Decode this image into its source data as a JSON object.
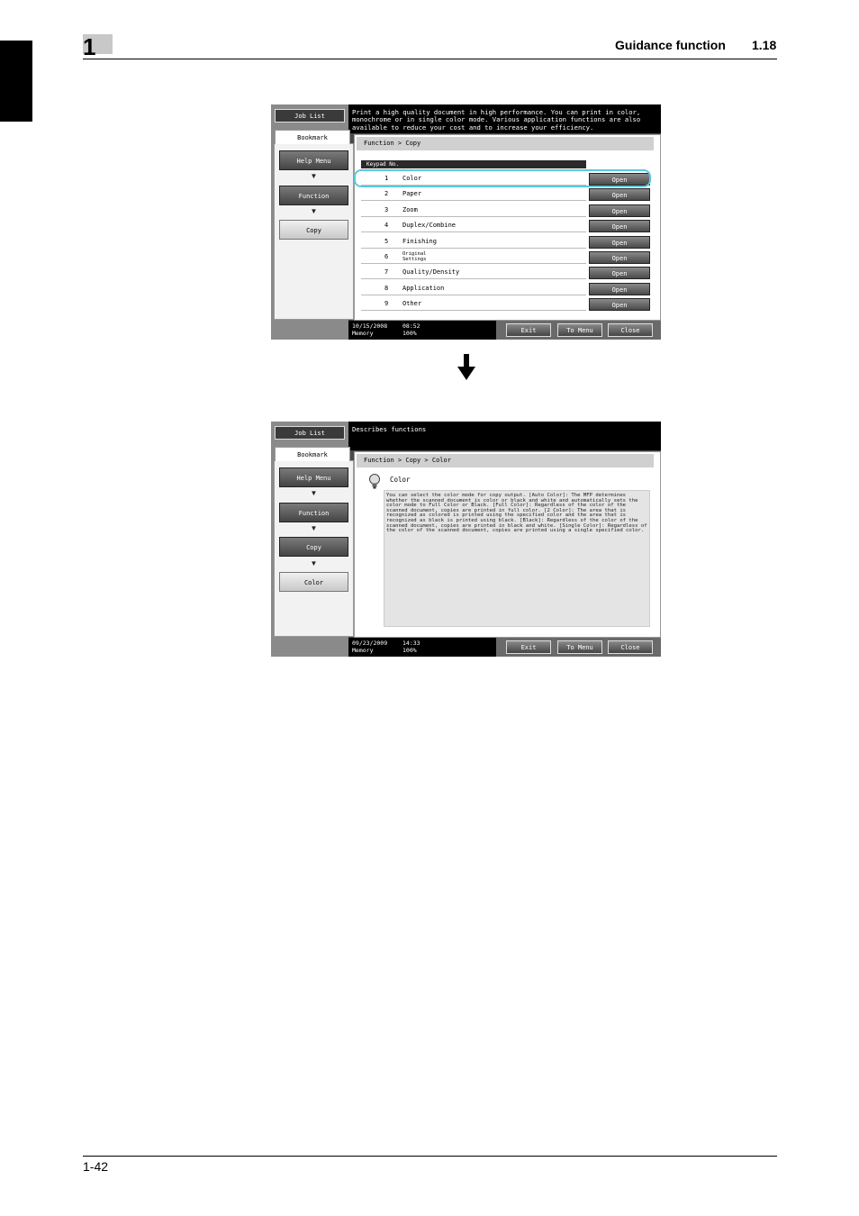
{
  "header": {
    "chapter": "1",
    "title": "Guidance function",
    "section": "1.18"
  },
  "footer": {
    "page": "1-42"
  },
  "screen1": {
    "message": "Print a high quality document in high performance. You can print in color, monochrome or in single color mode. Various application functions are also available to reduce your cost and to increase your efficiency.",
    "job_list": "Job List",
    "bookmark": "Bookmark",
    "nav": [
      "Help Menu",
      "Function",
      "Copy"
    ],
    "breadcrumb": "Function > Copy",
    "keypad_header": "Keypad No.",
    "items": [
      {
        "num": "1",
        "label": "Color"
      },
      {
        "num": "2",
        "label": "Paper"
      },
      {
        "num": "3",
        "label": "Zoom"
      },
      {
        "num": "4",
        "label": "Duplex/Combine"
      },
      {
        "num": "5",
        "label": "Finishing"
      },
      {
        "num": "6",
        "label": "Original Settings"
      },
      {
        "num": "7",
        "label": "Quality/Density"
      },
      {
        "num": "8",
        "label": "Application"
      },
      {
        "num": "9",
        "label": "Other"
      }
    ],
    "open_label": "Open",
    "date": "10/15/2008",
    "time": "08:52",
    "memory_label": "Memory",
    "memory_value": "100%",
    "buttons": [
      "Exit",
      "To Menu",
      "Close"
    ]
  },
  "screen2": {
    "message": "Describes functions",
    "job_list": "Job List",
    "bookmark": "Bookmark",
    "nav": [
      "Help Menu",
      "Function",
      "Copy",
      "Color"
    ],
    "breadcrumb": "Function > Copy > Color",
    "item_title": "Color",
    "description": "You can select the color mode for copy output. [Auto Color]: The MFP determines whether the scanned document is color or black and white and automatically sets the color mode to Full Color or Black. [Full Color]: Regardless of the color of the scanned document, copies are printed in full color. [2 Color]: The area that is recognized as colored is printed using the specified color and the area that is recognized as black is printed using black. [Black]: Regardless of the color of the scanned document, copies are printed in black and white. [Single Color]: Regardless of the color of the scanned document, copies are printed using a single specified color.",
    "date": "09/23/2009",
    "time": "14:33",
    "memory_label": "Memory",
    "memory_value": "100%",
    "buttons": [
      "Exit",
      "To Menu",
      "Close"
    ]
  }
}
